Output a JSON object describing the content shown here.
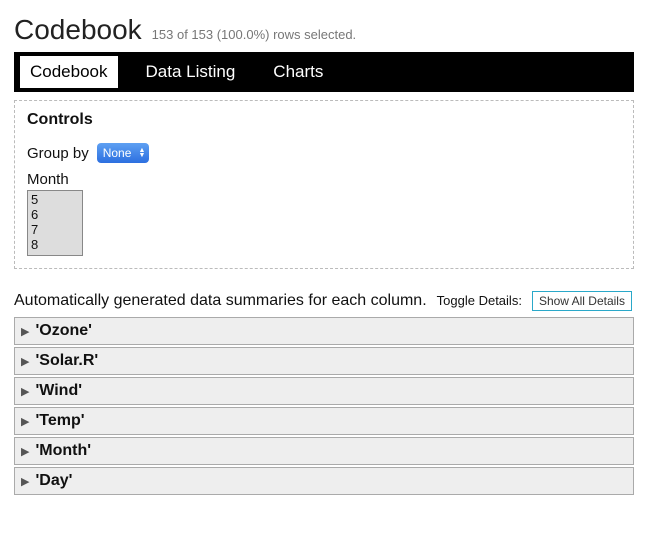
{
  "header": {
    "title": "Codebook",
    "subtitle": "153 of 153 (100.0%) rows selected."
  },
  "tabs": [
    {
      "label": "Codebook",
      "active": true
    },
    {
      "label": "Data Listing",
      "active": false
    },
    {
      "label": "Charts",
      "active": false
    }
  ],
  "controls": {
    "title": "Controls",
    "groupby_label": "Group by",
    "groupby_value": "None",
    "month_label": "Month",
    "month_options": [
      "5",
      "6",
      "7",
      "8"
    ]
  },
  "summary": {
    "text": "Automatically generated data summaries for each column.",
    "toggle_label": "Toggle Details:",
    "button": "Show All Details"
  },
  "variables": [
    {
      "name": "'Ozone'"
    },
    {
      "name": "'Solar.R'"
    },
    {
      "name": "'Wind'"
    },
    {
      "name": "'Temp'"
    },
    {
      "name": "'Month'"
    },
    {
      "name": "'Day'"
    }
  ]
}
